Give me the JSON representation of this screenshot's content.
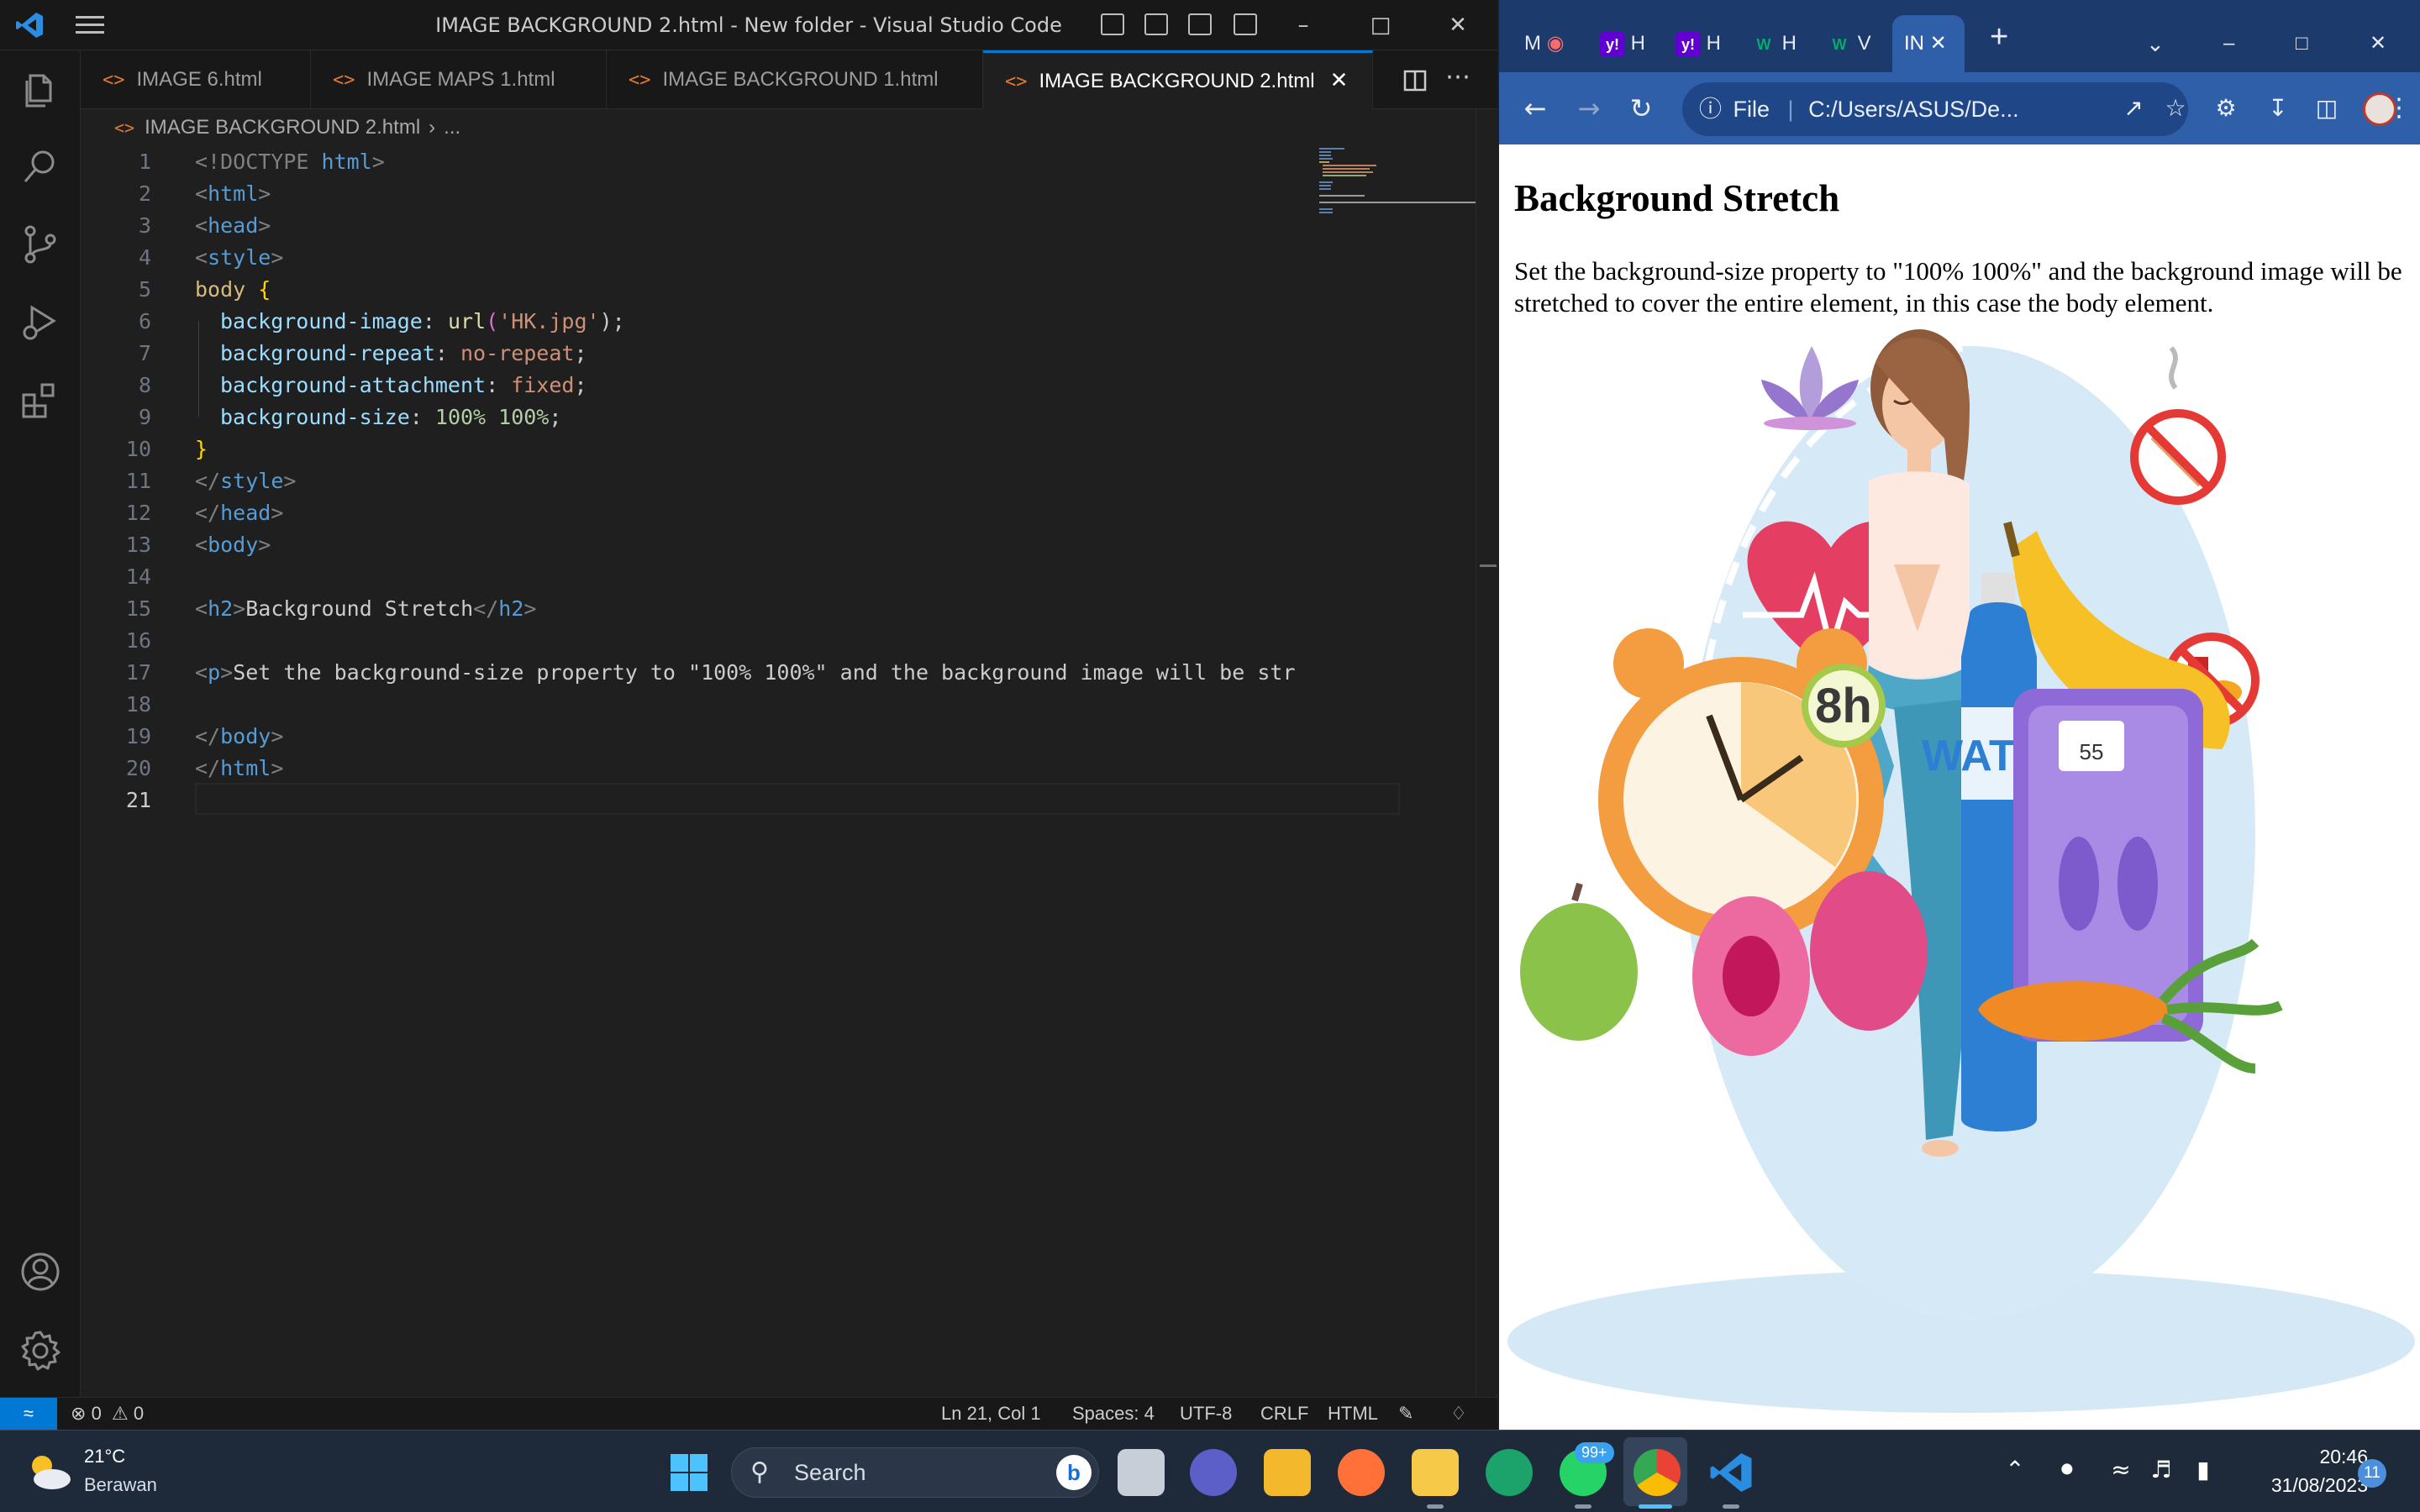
{
  "vscode": {
    "title": "IMAGE BACKGROUND 2.html - New folder - Visual Studio Code",
    "tabs": [
      {
        "label": "IMAGE 6.html"
      },
      {
        "label": "IMAGE MAPS 1.html"
      },
      {
        "label": "IMAGE BACKGROUND 1.html"
      },
      {
        "label": "IMAGE BACKGROUND 2.html"
      }
    ],
    "breadcrumb": {
      "file": "IMAGE BACKGROUND 2.html",
      "more": "..."
    },
    "line_numbers": [
      "1",
      "2",
      "3",
      "4",
      "5",
      "6",
      "7",
      "8",
      "9",
      "10",
      "11",
      "12",
      "13",
      "14",
      "15",
      "16",
      "17",
      "18",
      "19",
      "20",
      "21"
    ],
    "code": [
      {
        "a": "<!DOCTYPE ",
        "b": "html",
        "c": ">"
      },
      {
        "a": "<",
        "b": "html",
        "c": ">"
      },
      {
        "a": "<",
        "b": "head",
        "c": ">"
      },
      {
        "a": "<",
        "b": "style",
        "c": ">"
      },
      {
        "sel": "body ",
        "br": "{"
      },
      {
        "prop": "background-image",
        "p": ": ",
        "fn": "url",
        "o": "(",
        "str": "'HK.jpg'",
        "c": ");"
      },
      {
        "prop": "background-repeat",
        "p": ": ",
        "str": "no-repeat",
        "c": ";"
      },
      {
        "prop": "background-attachment",
        "p": ": ",
        "str": "fixed",
        "c": ";"
      },
      {
        "prop": "background-size",
        "p": ": ",
        "num": "100% 100%",
        "c": ";"
      },
      {
        "br": "}"
      },
      {
        "a": "</",
        "b": "style",
        "c": ">"
      },
      {
        "a": "</",
        "b": "head",
        "c": ">"
      },
      {
        "a": "<",
        "b": "body",
        "c": ">"
      },
      {},
      {
        "a": "<",
        "b": "h2",
        "c": ">",
        "text": "Background Stretch",
        "a2": "</",
        "b2": "h2",
        "c2": ">"
      },
      {},
      {
        "a": "<",
        "b": "p",
        "c": ">",
        "text": "Set the background-size property to \"100% 100%\" and the background image will be str"
      },
      {},
      {
        "a": "</",
        "b": "body",
        "c": ">"
      },
      {
        "a": "</",
        "b": "html",
        "c": ">"
      },
      {}
    ],
    "status": {
      "errors": "0",
      "warnings": "0",
      "position": "Ln 21, Col 1",
      "spaces": "Spaces: 4",
      "encoding": "UTF-8",
      "eol": "CRLF",
      "language": "HTML"
    }
  },
  "chrome": {
    "tabs": [
      {
        "label": "M"
      },
      {
        "label": "H"
      },
      {
        "label": "H"
      },
      {
        "label": "H"
      },
      {
        "label": "V"
      },
      {
        "label": "IN"
      }
    ],
    "address_scheme": "File",
    "address": "C:/Users/ASUS/De...",
    "page": {
      "heading": "Background Stretch",
      "paragraph": "Set the background-size property to \"100% 100%\" and the background image will be stretched to cover the entire element, in this case the body element.",
      "illustration_labels": {
        "sleep": "8h",
        "bottle": "WATER",
        "scale": "55"
      }
    }
  },
  "taskbar": {
    "weather_temp": "21°C",
    "weather_desc": "Berawan",
    "search_placeholder": "Search",
    "whatsapp_badge": "99+",
    "time": "20:46",
    "date": "31/08/2023",
    "notifications": "11"
  },
  "colors": {
    "vscode_bg": "#1f1f1f",
    "vscode_accent": "#0078d4",
    "chrome_frame": "#1c3a6b",
    "chrome_toolbar": "#2f5fa8",
    "taskbar": "#1e2a3a"
  }
}
